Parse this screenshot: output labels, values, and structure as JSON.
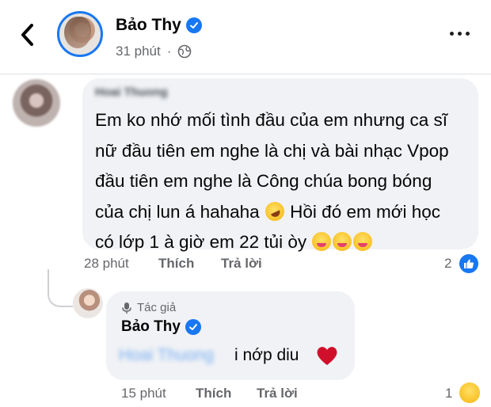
{
  "header": {
    "name": "Bảo Thy",
    "time": "31 phút",
    "icons": {
      "back": "chevron-left-icon",
      "verified": "verified-badge-icon",
      "privacy": "globe-icon",
      "more": "more-horizontal-icon"
    }
  },
  "comment": {
    "author": "Hoai Thuong",
    "text_parts": [
      "Em ko nhớ mối tình đầu của em nhưng ca sĩ\nnữ đầu tiên em nghe là chị và bài nhạc Vpop\nđầu tiên em nghe là Công chúa bong bóng\ncủa chị lun á hahaha ",
      " Hồi đó em mới học\ncó lớp 1 à giờ em 22 tủi òy "
    ],
    "time": "28 phút",
    "like_label": "Thích",
    "reply_label": "Trả lời",
    "reaction_count": "2",
    "reaction_icon": "like-icon"
  },
  "reply": {
    "author_tag": "Tác giả",
    "author": "Bảo Thy",
    "mention": "Hoai Thuong",
    "text": "i nớp diu",
    "time": "15 phút",
    "like_label": "Thích",
    "reply_label": "Trả lời",
    "reaction_count": "1",
    "reaction_icon": "care-icon"
  },
  "colors": {
    "accent": "#1877f2",
    "bubble": "#f0f2f5",
    "meta": "#65676b",
    "heart": "#d0102a"
  }
}
